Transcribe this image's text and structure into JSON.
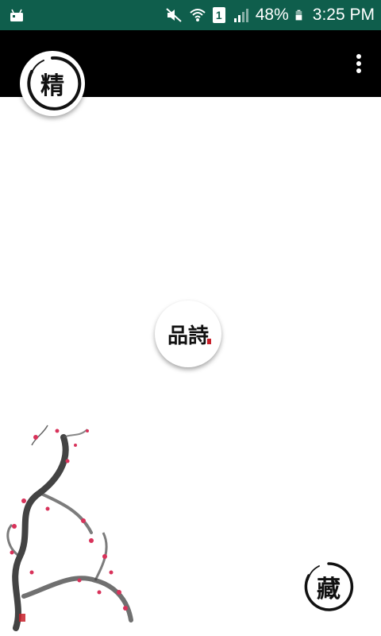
{
  "status_bar": {
    "sim_slot": "1",
    "battery_percent": "48%",
    "time": "3:25 PM",
    "icons": [
      "android-notification-icon",
      "mute-icon",
      "wifi-icon",
      "sim-1-icon",
      "signal-icon",
      "battery-icon"
    ]
  },
  "app_bar": {
    "menu_icon": "overflow-menu-icon",
    "logo_char": "精"
  },
  "center_button": {
    "label": "品詩"
  },
  "bottom_seal": {
    "label": "藏"
  },
  "colors": {
    "status_bar": "#0f5e4c",
    "app_bar": "#000000",
    "background": "#ffffff",
    "ink": "#111111",
    "plum_blossom": "#d8325a"
  }
}
